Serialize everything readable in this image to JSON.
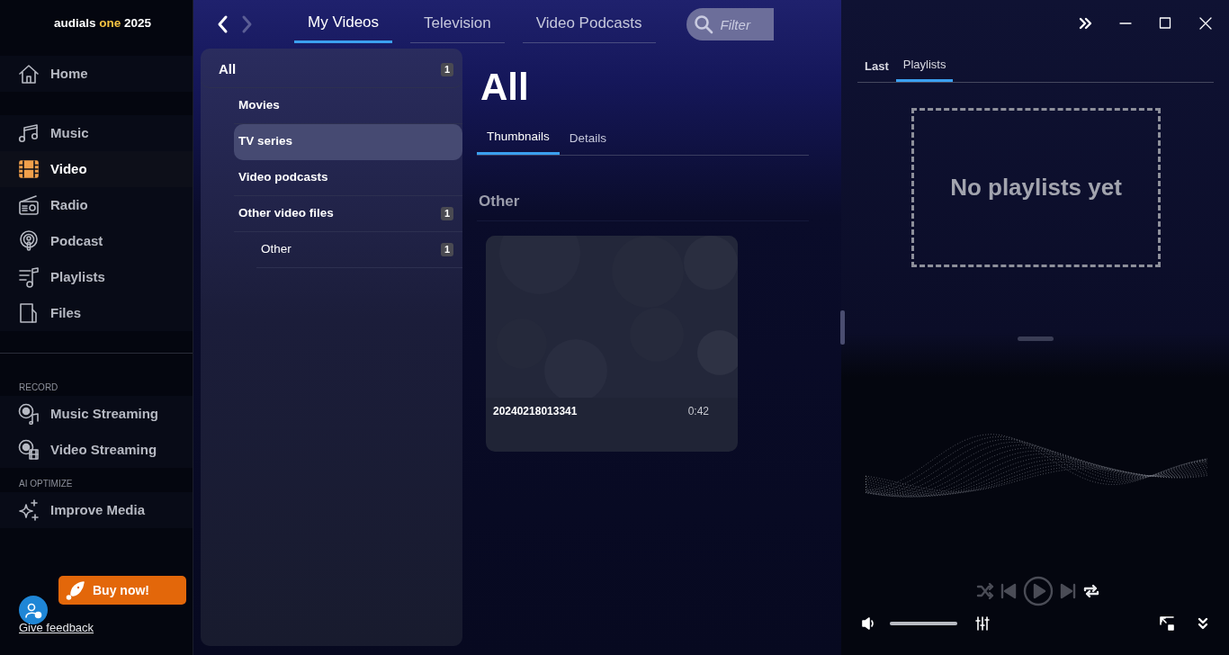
{
  "logo": {
    "name": "audials",
    "edition": "one",
    "year": "2025"
  },
  "nav_sections": [
    {
      "items": [
        {
          "label": "Home",
          "selected": false
        }
      ]
    },
    {
      "items": [
        {
          "label": "Music",
          "selected": false
        },
        {
          "label": "Video",
          "selected": true
        },
        {
          "label": "Radio",
          "selected": false
        },
        {
          "label": "Podcast",
          "selected": false
        },
        {
          "label": "Playlists",
          "selected": false
        },
        {
          "label": "Files",
          "selected": false
        }
      ]
    },
    {
      "heading": "RECORD",
      "items": [
        {
          "label": "Music Streaming",
          "selected": false
        },
        {
          "label": "Video Streaming",
          "selected": false
        }
      ]
    },
    {
      "heading": "AI OPTIMIZE",
      "items": [
        {
          "label": "Improve Media",
          "selected": false
        }
      ]
    }
  ],
  "buy_button": "Buy now!",
  "feedback_link": "Give feedback",
  "history": {
    "back_disabled": false,
    "forward_disabled": true
  },
  "top_tabs": [
    {
      "label": "My Videos",
      "selected": true
    },
    {
      "label": "Television",
      "selected": false
    },
    {
      "label": "Video Podcasts",
      "selected": false
    }
  ],
  "filter": {
    "placeholder": "Filter"
  },
  "tree": [
    {
      "label": "All",
      "count": "1",
      "selected": false,
      "children": [
        {
          "label": "Movies",
          "selected": false
        },
        {
          "label": "TV series",
          "selected": true
        },
        {
          "label": "Video podcasts",
          "selected": false
        },
        {
          "label": "Other video files",
          "count": "1",
          "selected": false,
          "children": [
            {
              "label": "Other",
              "count": "1",
              "selected": false
            }
          ]
        }
      ]
    }
  ],
  "content": {
    "title": "All",
    "view_tabs": [
      {
        "label": "Thumbnails",
        "selected": true
      },
      {
        "label": "Details",
        "selected": false
      }
    ],
    "section": "Other",
    "videos": [
      {
        "title": "20240218013341",
        "duration": "0:42",
        "kind": "picture"
      }
    ]
  },
  "side_tabs": [
    {
      "label": "Last",
      "selected": false
    },
    {
      "label": "Playlists",
      "selected": true
    }
  ],
  "playlists_empty": "No playlists yet",
  "player": {
    "volume": {
      "level": 1.0
    }
  }
}
